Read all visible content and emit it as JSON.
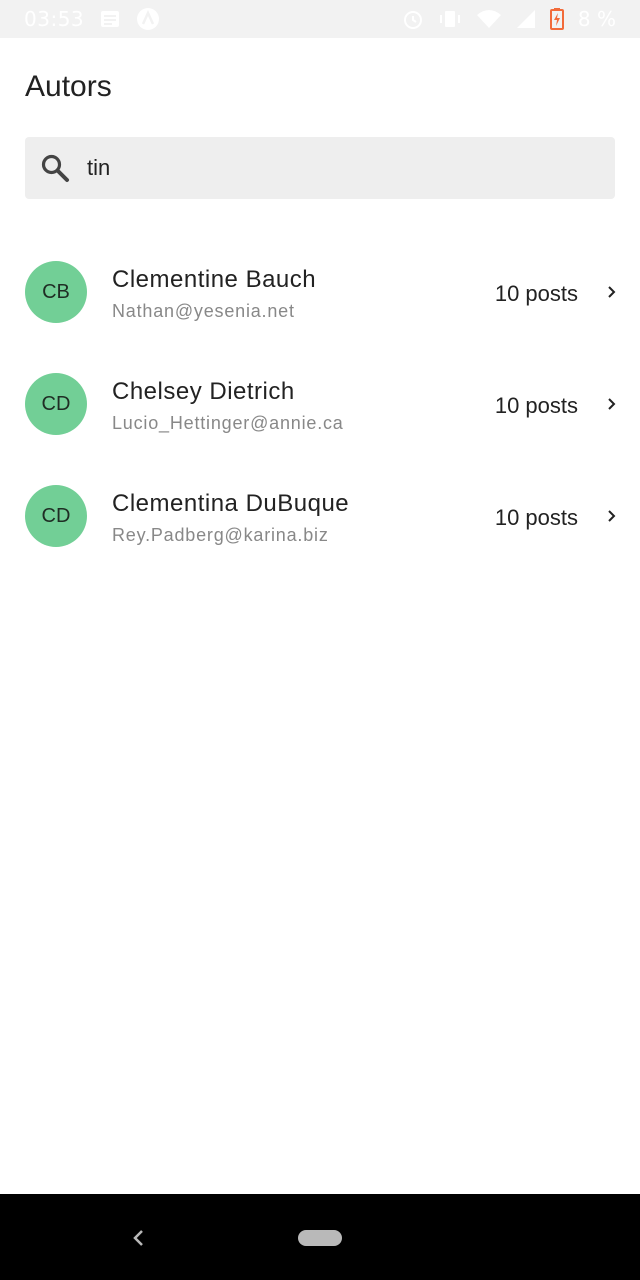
{
  "status_bar": {
    "time": "03:53",
    "battery_text": "8 %",
    "icons": [
      "notification-icon",
      "app-icon",
      "alarm-icon",
      "vibrate-icon",
      "wifi-icon",
      "signal-icon",
      "battery-charging-icon"
    ]
  },
  "header": {
    "title": "Autors"
  },
  "search": {
    "value": "tin",
    "icon": "search-icon"
  },
  "authors": [
    {
      "initials": "CB",
      "name": "Clementine Bauch",
      "email": "Nathan@yesenia.net",
      "posts": "10 posts"
    },
    {
      "initials": "CD",
      "name": "Chelsey Dietrich",
      "email": "Lucio_Hettinger@annie.ca",
      "posts": "10 posts"
    },
    {
      "initials": "CD",
      "name": "Clementina DuBuque",
      "email": "Rey.Padberg@karina.biz",
      "posts": "10 posts"
    }
  ],
  "colors": {
    "avatar": "#72cf96",
    "search_background": "#eeeeee",
    "nav_bar": "#000000"
  }
}
